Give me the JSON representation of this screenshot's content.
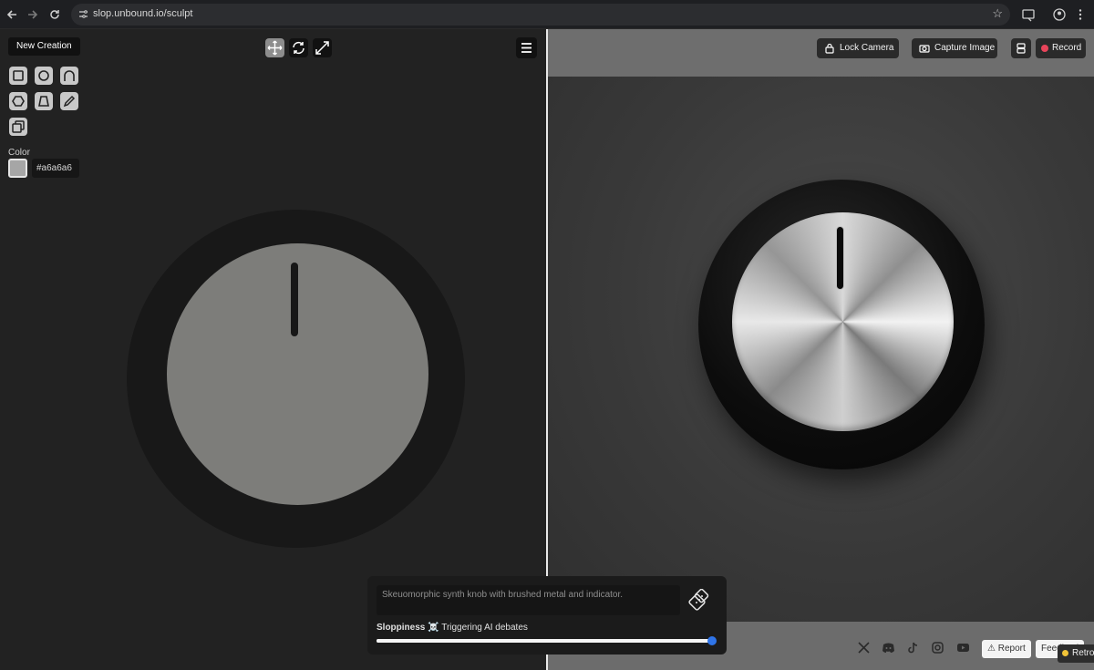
{
  "browser": {
    "url": "slop.unbound.io/sculpt",
    "icons": [
      "back-icon",
      "forward-icon",
      "reload-icon",
      "site-settings-icon",
      "bookmark-star-icon",
      "tab-search-icon",
      "profile-icon",
      "more-icon"
    ]
  },
  "left": {
    "new_creation_label": "New Creation",
    "tools": [
      "box-icon",
      "sphere-icon",
      "arch-icon",
      "hexagon-icon",
      "trapezoid-icon",
      "pencil-icon",
      "duplicate-icon"
    ],
    "top_controls": [
      "move-icon",
      "rotate-icon",
      "expand-icon"
    ],
    "color_label": "Color",
    "color_value": "#a6a6a6"
  },
  "right": {
    "lock_camera_label": "Lock Camera",
    "capture_image_label": "Capture Image",
    "record_label": "Record",
    "record_color": "#e8445a"
  },
  "prompt": {
    "text": "Skeuomorphic synth knob with brushed metal and indicator.",
    "sloppiness_label": "Sloppiness",
    "sloppiness_emoji": "☠️",
    "sloppiness_status": "Triggering AI debates",
    "sloppiness_level": 1.0,
    "accent": "#2f74e8"
  },
  "footer": {
    "socials": [
      "x-icon",
      "discord-icon",
      "tiktok-icon",
      "instagram-icon",
      "youtube-icon"
    ],
    "report_label": "⚠ Report",
    "feedback_label": "Feedback",
    "retro_label": "Retro"
  }
}
